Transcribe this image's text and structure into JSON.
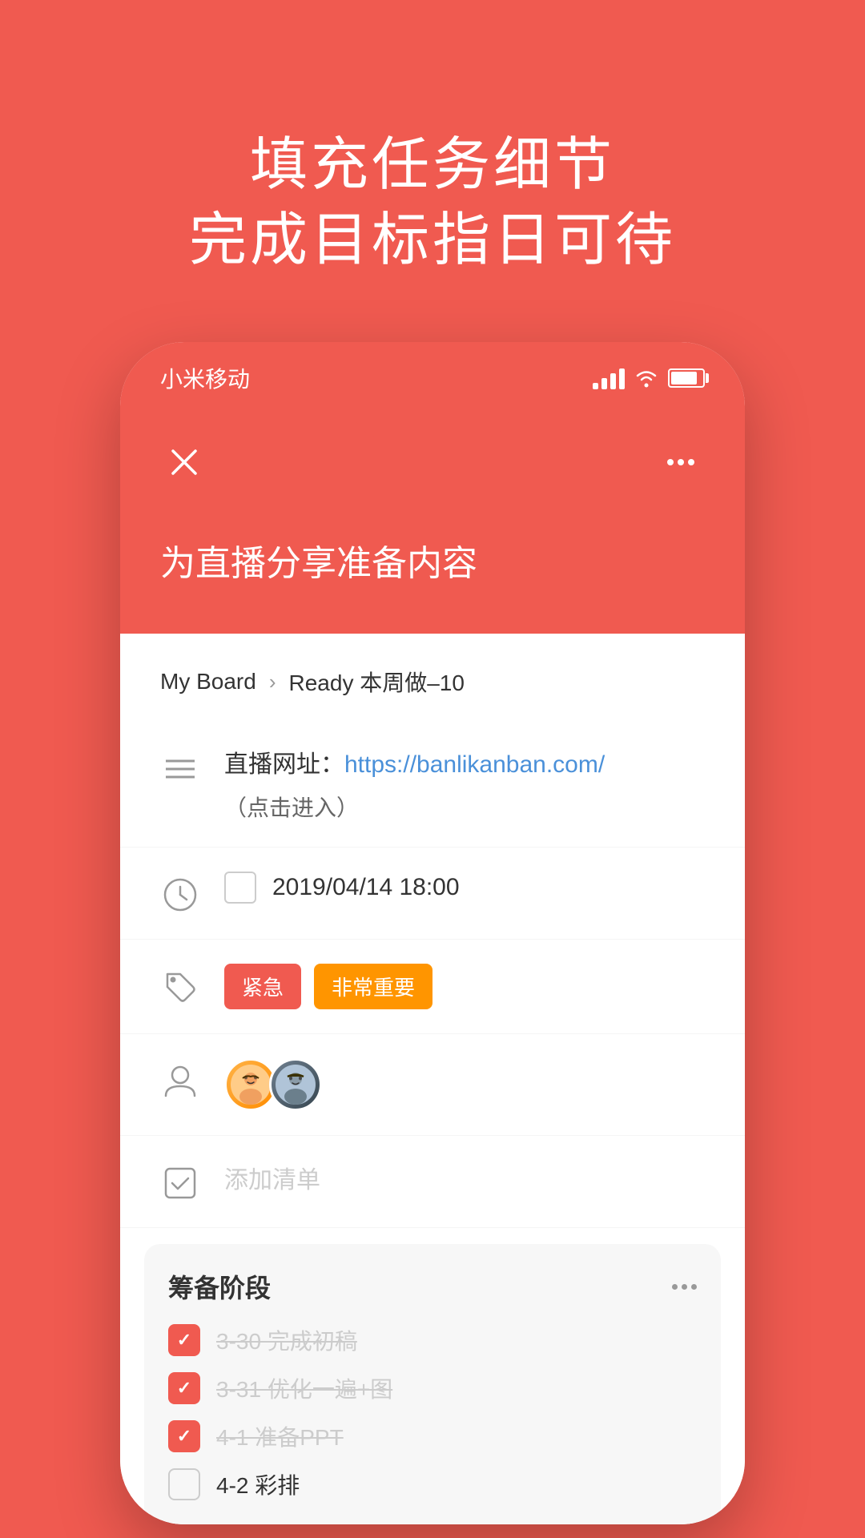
{
  "hero": {
    "line1": "填充任务细节",
    "line2": "完成目标指日可待"
  },
  "status_bar": {
    "carrier": "小米移动",
    "time": ""
  },
  "app_header": {
    "close_label": "×",
    "more_label": "···"
  },
  "task": {
    "title": "为直播分享准备内容"
  },
  "breadcrumb": {
    "board": "My Board",
    "separator": "›",
    "column": "Ready 本周做–10"
  },
  "description": {
    "icon": "menu-icon",
    "text_prefix": "直播网址：",
    "link": "https://banlikanban.com/",
    "link_sub": "（点击进入）"
  },
  "datetime": {
    "icon": "clock-icon",
    "value": "2019/04/14 18:00"
  },
  "tags": {
    "icon": "tag-icon",
    "items": [
      {
        "label": "紧急",
        "type": "urgent"
      },
      {
        "label": "非常重要",
        "type": "important"
      }
    ]
  },
  "members": {
    "icon": "person-icon",
    "count": 2
  },
  "checklist_add": {
    "icon": "checklist-icon",
    "placeholder": "添加清单"
  },
  "checklist_section": {
    "title": "筹备阶段",
    "items": [
      {
        "text": "3-30 完成初稿",
        "done": true
      },
      {
        "text": "3-31 优化一遍+图",
        "done": true
      },
      {
        "text": "4-1 准备PPT",
        "done": true
      },
      {
        "text": "4-2 彩排",
        "done": false
      }
    ]
  }
}
